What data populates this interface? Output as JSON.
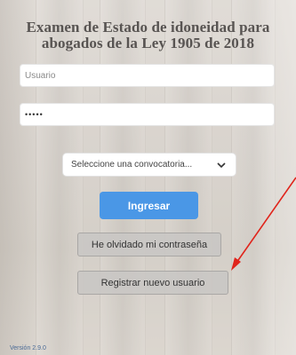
{
  "title": {
    "line1": "Examen de Estado de idoneidad para",
    "line2": "abogados de la Ley 1905 de 2018"
  },
  "form": {
    "username_placeholder": "Usuario",
    "password_value": "•••••",
    "convocatoria_selected": "Seleccione una convocatoria..."
  },
  "buttons": {
    "login": "Ingresar",
    "forgot_password": "He olvidado mi contraseña",
    "register": "Registrar nuevo usuario"
  },
  "footer": {
    "version": "Versión 2.9.0"
  },
  "colors": {
    "primary_button": "#4a97e6",
    "annotation_arrow": "#e0241b"
  }
}
